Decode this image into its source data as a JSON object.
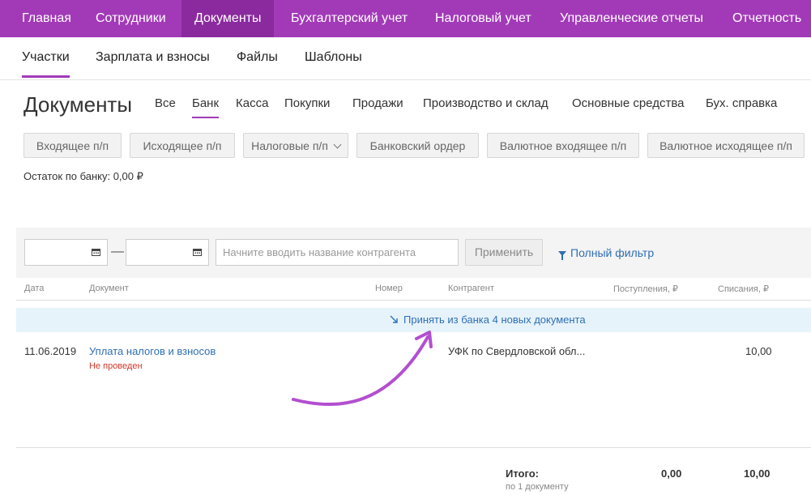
{
  "topnav": {
    "items": [
      "Главная",
      "Сотрудники",
      "Документы",
      "Бухгалтерский учет",
      "Налоговый учет",
      "Управленческие отчеты",
      "Отчетность"
    ],
    "active_index": 2
  },
  "subnav": {
    "items": [
      "Участки",
      "Зарплата и взносы",
      "Файлы",
      "Шаблоны"
    ],
    "active_index": 0
  },
  "page": {
    "title": "Документы",
    "tabs": [
      "Все",
      "Банк",
      "Касса",
      "Покупки",
      "Продажи",
      "Производство и склад",
      "Основные средства",
      "Бух. справка"
    ],
    "active_tab_index": 1
  },
  "actions": [
    "Входящее п/п",
    "Исходящее п/п",
    "Налоговые п/п",
    "Банковский ордер",
    "Валютное входящее п/п",
    "Валютное исходящее п/п"
  ],
  "balance": "Остаток по банку: 0,00 ₽",
  "filter": {
    "search_placeholder": "Начните вводить название контрагента",
    "apply_label": "Применить",
    "full_filter_label": "Полный фильтр",
    "date_separator": "—"
  },
  "table": {
    "headers": {
      "date": "Дата",
      "document": "Документ",
      "number": "Номер",
      "counterparty": "Контрагент",
      "income": "Поступления, ₽",
      "expense": "Списания, ₽"
    },
    "bank_import": "Принять из банка 4 новых документа",
    "rows": [
      {
        "date": "11.06.2019",
        "document": "Уплата налогов и взносов",
        "status": "Не проведен",
        "number": "",
        "counterparty": "УФК по Свердловской обл...",
        "income": "",
        "expense": "10,00"
      }
    ],
    "totals": {
      "label": "Итого:",
      "sub": "по 1 документу",
      "income": "0,00",
      "expense": "10,00"
    }
  },
  "colors": {
    "brand": "#a23ab8",
    "link": "#2f6fb4",
    "error": "#d0382c",
    "highlight": "#e7f3fb",
    "annotation_arrow": "#b34fd0"
  }
}
